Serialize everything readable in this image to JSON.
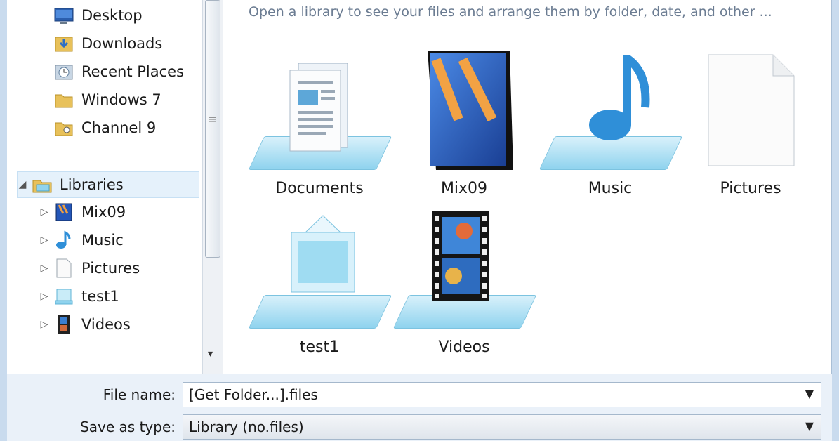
{
  "content": {
    "hint": "Open a library to see your files and arrange them by folder, date, and other ...",
    "libraries": [
      {
        "label": "Documents",
        "icon": "documents-library-icon"
      },
      {
        "label": "Mix09",
        "icon": "mix09-library-icon"
      },
      {
        "label": "Music",
        "icon": "music-library-icon"
      },
      {
        "label": "Pictures",
        "icon": "pictures-library-icon"
      },
      {
        "label": "test1",
        "icon": "test1-library-icon"
      },
      {
        "label": "Videos",
        "icon": "videos-library-icon"
      }
    ]
  },
  "nav": {
    "favorites": [
      {
        "label": "Desktop",
        "icon": "desktop-icon"
      },
      {
        "label": "Downloads",
        "icon": "downloads-icon"
      },
      {
        "label": "Recent Places",
        "icon": "recent-places-icon"
      },
      {
        "label": "Windows 7",
        "icon": "folder-icon"
      },
      {
        "label": "Channel 9",
        "icon": "folder-icon"
      }
    ],
    "libraries_root": {
      "label": "Libraries",
      "expander": "◢",
      "icon": "libraries-icon"
    },
    "libraries": [
      {
        "label": "Mix09",
        "expander": "▷",
        "icon": "mix09-icon"
      },
      {
        "label": "Music",
        "expander": "▷",
        "icon": "music-icon"
      },
      {
        "label": "Pictures",
        "expander": "▷",
        "icon": "pictures-icon"
      },
      {
        "label": "test1",
        "expander": "▷",
        "icon": "test1-icon"
      },
      {
        "label": "Videos",
        "expander": "▷",
        "icon": "videos-icon"
      }
    ]
  },
  "fields": {
    "file_name_label": "File name:",
    "file_name_value": "[Get Folder...].files",
    "save_type_label": "Save as type:",
    "save_type_value": "Library (no.files)"
  },
  "colors": {
    "selection": "#e5f1fb",
    "accent": "#8fd3ee",
    "hint_text": "#6b7c92"
  }
}
